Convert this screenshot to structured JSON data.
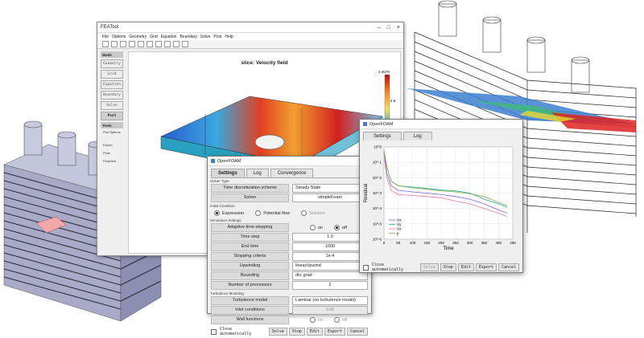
{
  "main_window": {
    "title": "FEATool",
    "menu": [
      "File",
      "Options",
      "Geometry",
      "Grid",
      "Equation",
      "Boundary",
      "Solve",
      "Post",
      "Help"
    ],
    "modes": [
      "Mode",
      "Geometry",
      "Grid",
      "Equation",
      "Boundary",
      "Solve",
      "Post"
    ],
    "tools_header": "Tools",
    "tools": [
      "Plot Options",
      "Export",
      "Plots",
      "Postview"
    ],
    "plot_title": "slice: Velocity field",
    "colorbar_max": "2.4679",
    "colorbar_mid": "2.5"
  },
  "settings_dialog": {
    "title": "OpenFOAM",
    "tabs": [
      "Settings",
      "Log",
      "Convergence"
    ],
    "solver_type_section": "Solver Type",
    "time_scheme_label": "Time discretization scheme",
    "time_scheme_value": "Steady State",
    "solver_label": "Solver",
    "solver_value": "simpleFoam",
    "initial_condition_section": "Initial Condition",
    "init_options": [
      "Expression",
      "Potential flow",
      "Solution"
    ],
    "sim_settings_section": "Simulation Settings",
    "adaptive_label": "Adaptive time-stepping",
    "adaptive_on": "on",
    "adaptive_off": "off",
    "time_step_label": "Time step",
    "time_step_value": "1.0",
    "end_time_label": "End time",
    "end_time_value": "1000",
    "stop_label": "Stopping criteria",
    "stop_value": "1e-4",
    "upwinding_label": "Upwinding",
    "upwinding_value": "linearUpwind",
    "bounding_label": "Bounding",
    "bounding_value": "div, grad",
    "procs_label": "Number of processors",
    "procs_value": "2",
    "turb_section": "Turbulence Modeling",
    "turb_label": "Turbulence model",
    "turb_value": "Laminar (no turbulence model)",
    "inlet_label": "Inlet conditions",
    "inlet_value": "Edit",
    "wall_label": "Wall functions",
    "wall_on": "on",
    "wall_off": "off",
    "close_auto": "Close automatically",
    "buttons": [
      "Solve",
      "Stop",
      "Edit",
      "Export",
      "Cancel"
    ]
  },
  "convergence_dialog": {
    "title": "OpenFOAM",
    "tabs": [
      "Settings",
      "Log"
    ],
    "ylabel": "Residual",
    "xlabel": "Time",
    "close_auto": "Close automatically",
    "buttons": [
      "Solve",
      "Stop",
      "Edit",
      "Export",
      "Cancel"
    ]
  },
  "chart_data": {
    "type": "line",
    "title": "",
    "xlabel": "Time",
    "ylabel": "Residual",
    "xlim": [
      0,
      450
    ],
    "ylim_log": [
      1e-06,
      1
    ],
    "x_ticks": [
      "0",
      "50",
      "100",
      "150",
      "200",
      "250",
      "300",
      "350",
      "400",
      "450"
    ],
    "y_ticks": [
      "10^0",
      "10^-1",
      "10^-2",
      "10^-3",
      "10^-4",
      "10^-5",
      "10^-6"
    ],
    "series": [
      {
        "name": "Ux",
        "color": "#7b68c8",
        "x": [
          0,
          10,
          25,
          50,
          100,
          150,
          200,
          250,
          300,
          350,
          400,
          430
        ],
        "y": [
          0.5,
          0.02,
          0.003,
          0.0015,
          0.0012,
          0.001,
          0.0008,
          0.0006,
          0.0004,
          0.0002,
          8e-05,
          5e-05
        ]
      },
      {
        "name": "Uy",
        "color": "#2aa6a0",
        "x": [
          0,
          10,
          25,
          50,
          100,
          150,
          200,
          250,
          300,
          350,
          400,
          430
        ],
        "y": [
          0.6,
          0.05,
          0.006,
          0.003,
          0.0025,
          0.002,
          0.0016,
          0.0014,
          0.001,
          0.0004,
          0.0002,
          0.00012
        ]
      },
      {
        "name": "Uz",
        "color": "#e6799c",
        "x": [
          0,
          10,
          25,
          50,
          100,
          150,
          200,
          250,
          300,
          350,
          400,
          430
        ],
        "y": [
          0.3,
          0.01,
          0.0015,
          0.0008,
          0.0007,
          0.0006,
          0.0005,
          0.0003,
          0.0002,
          0.0001,
          5e-05,
          3e-05
        ]
      },
      {
        "name": "p",
        "color": "#7ab04a",
        "x": [
          0,
          10,
          25,
          50,
          100,
          150,
          200,
          250,
          300,
          350,
          400,
          430
        ],
        "y": [
          0.5,
          0.05,
          0.006,
          0.003,
          0.0022,
          0.0018,
          0.0014,
          0.0012,
          0.0009,
          0.0006,
          0.00025,
          0.00015
        ]
      }
    ]
  }
}
